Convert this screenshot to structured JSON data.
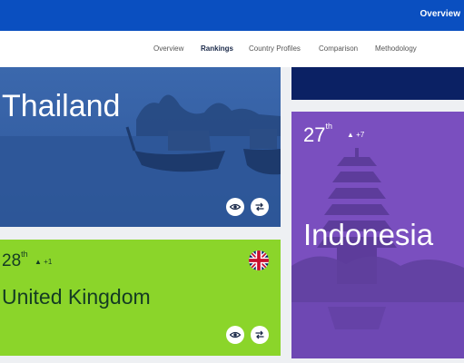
{
  "header": {
    "overview_label": "Overview"
  },
  "subnav": {
    "items": [
      {
        "label": "Overview"
      },
      {
        "label": "Rankings"
      },
      {
        "label": "Country Profiles"
      },
      {
        "label": "Comparison"
      },
      {
        "label": "Methodology"
      }
    ],
    "active": "Rankings"
  },
  "cards": {
    "thailand": {
      "name": "Thailand"
    },
    "uk": {
      "name": "United Kingdom",
      "rank_number": "28",
      "rank_suffix": "th",
      "change": "+1"
    },
    "indonesia": {
      "name": "Indonesia",
      "rank_number": "27",
      "rank_suffix": "th",
      "change": "+7"
    }
  },
  "colors": {
    "topbar": "#0a4fc0",
    "thailand_card": "#3560a6",
    "uk_card": "#8bd52a",
    "indonesia_card": "#7a4fbf",
    "navy_card": "#0b2164"
  },
  "icons": {
    "view": "eye-icon",
    "compare": "swap-arrows-icon",
    "up": "triangle-up-icon"
  }
}
